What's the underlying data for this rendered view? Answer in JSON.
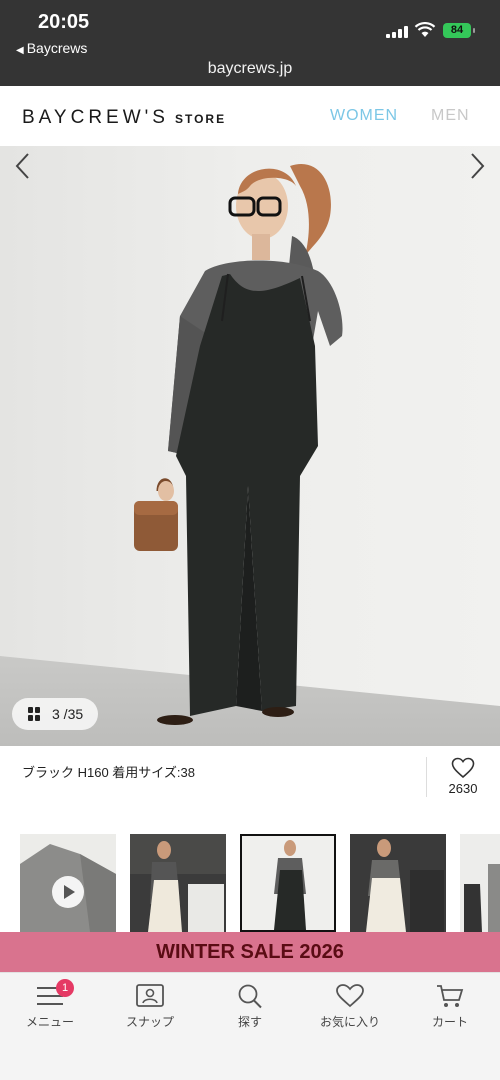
{
  "status_bar": {
    "time": "20:05",
    "back_app": "Baycrews",
    "url": "baycrews.jp",
    "battery": "84"
  },
  "header": {
    "logo": "BAYCREW'S",
    "logo_store": "STORE",
    "nav": [
      {
        "label": "WOMEN",
        "active": true
      },
      {
        "label": "MEN",
        "active": false
      }
    ]
  },
  "gallery": {
    "counter": "3 /35",
    "caption": "ブラック H160 着用サイズ:38",
    "favorite_count": "2630"
  },
  "banner": {
    "text": "WINTER SALE 2026"
  },
  "tabbar": {
    "items": [
      {
        "label": "メニュー",
        "icon": "menu-icon",
        "badge": "1"
      },
      {
        "label": "スナップ",
        "icon": "snap-icon"
      },
      {
        "label": "探す",
        "icon": "search-icon"
      },
      {
        "label": "お気に入り",
        "icon": "heart-icon"
      },
      {
        "label": "カート",
        "icon": "cart-icon"
      }
    ]
  },
  "colors": {
    "accent_women": "#7cc7e6",
    "banner_bg": "#d9738e",
    "badge": "#e53964"
  }
}
